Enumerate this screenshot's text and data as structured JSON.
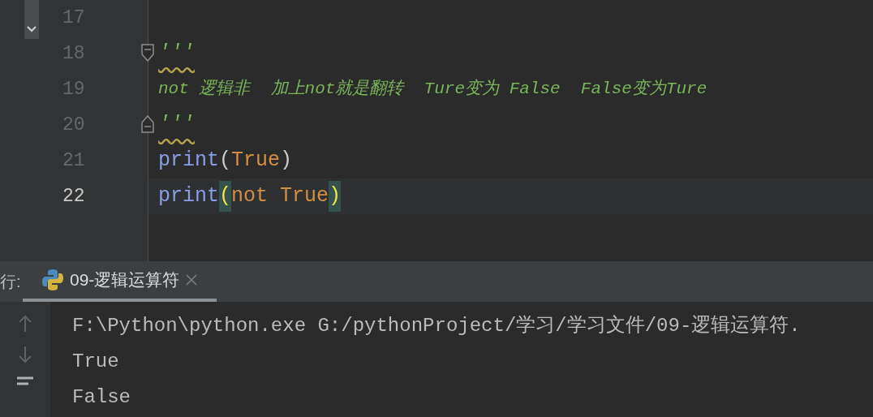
{
  "editor": {
    "lines": [
      {
        "number": "17",
        "current": false
      },
      {
        "number": "18",
        "current": false,
        "fold_start": true,
        "tokens": [
          {
            "text": "'''",
            "kind": "docstring",
            "warning": true
          }
        ]
      },
      {
        "number": "19",
        "current": false,
        "tokens": [
          {
            "text": "not 逻辑非  加上not就是翻转  Ture变为 False  False变为Ture",
            "kind": "docstring",
            "warning": false
          }
        ]
      },
      {
        "number": "20",
        "current": false,
        "fold_end": true,
        "tokens": [
          {
            "text": "'''",
            "kind": "docstring",
            "warning": true
          }
        ]
      },
      {
        "number": "21",
        "current": false,
        "tokens": [
          {
            "text": "print",
            "kind": "builtin"
          },
          {
            "text": "(",
            "kind": "paren",
            "matched": false
          },
          {
            "text": "True",
            "kind": "keyword"
          },
          {
            "text": ")",
            "kind": "paren",
            "matched": false
          }
        ]
      },
      {
        "number": "22",
        "current": true,
        "tokens": [
          {
            "text": "print",
            "kind": "builtin"
          },
          {
            "text": "(",
            "kind": "paren",
            "matched": true
          },
          {
            "text": "not True",
            "kind": "keyword"
          },
          {
            "text": ")",
            "kind": "paren",
            "matched": true
          }
        ]
      }
    ]
  },
  "run_panel": {
    "label": "行:",
    "tabs": [
      {
        "title": "09-逻辑运算符",
        "selected": true
      }
    ]
  },
  "console": {
    "lines": [
      "F:\\Python\\python.exe G:/pythonProject/学习/学习文件/09-逻辑运算符.",
      "True",
      "False"
    ]
  }
}
